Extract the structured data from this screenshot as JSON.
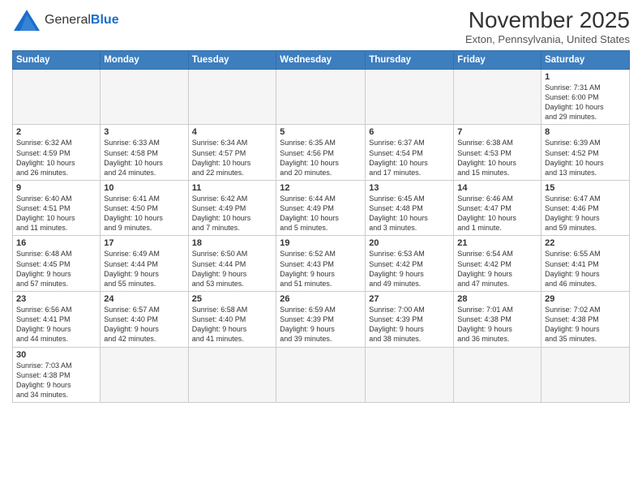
{
  "logo": {
    "text_general": "General",
    "text_blue": "Blue"
  },
  "title": "November 2025",
  "subtitle": "Exton, Pennsylvania, United States",
  "weekdays": [
    "Sunday",
    "Monday",
    "Tuesday",
    "Wednesday",
    "Thursday",
    "Friday",
    "Saturday"
  ],
  "weeks": [
    [
      {
        "day": "",
        "info": ""
      },
      {
        "day": "",
        "info": ""
      },
      {
        "day": "",
        "info": ""
      },
      {
        "day": "",
        "info": ""
      },
      {
        "day": "",
        "info": ""
      },
      {
        "day": "",
        "info": ""
      },
      {
        "day": "1",
        "info": "Sunrise: 7:31 AM\nSunset: 6:00 PM\nDaylight: 10 hours\nand 29 minutes."
      }
    ],
    [
      {
        "day": "2",
        "info": "Sunrise: 6:32 AM\nSunset: 4:59 PM\nDaylight: 10 hours\nand 26 minutes."
      },
      {
        "day": "3",
        "info": "Sunrise: 6:33 AM\nSunset: 4:58 PM\nDaylight: 10 hours\nand 24 minutes."
      },
      {
        "day": "4",
        "info": "Sunrise: 6:34 AM\nSunset: 4:57 PM\nDaylight: 10 hours\nand 22 minutes."
      },
      {
        "day": "5",
        "info": "Sunrise: 6:35 AM\nSunset: 4:56 PM\nDaylight: 10 hours\nand 20 minutes."
      },
      {
        "day": "6",
        "info": "Sunrise: 6:37 AM\nSunset: 4:54 PM\nDaylight: 10 hours\nand 17 minutes."
      },
      {
        "day": "7",
        "info": "Sunrise: 6:38 AM\nSunset: 4:53 PM\nDaylight: 10 hours\nand 15 minutes."
      },
      {
        "day": "8",
        "info": "Sunrise: 6:39 AM\nSunset: 4:52 PM\nDaylight: 10 hours\nand 13 minutes."
      }
    ],
    [
      {
        "day": "9",
        "info": "Sunrise: 6:40 AM\nSunset: 4:51 PM\nDaylight: 10 hours\nand 11 minutes."
      },
      {
        "day": "10",
        "info": "Sunrise: 6:41 AM\nSunset: 4:50 PM\nDaylight: 10 hours\nand 9 minutes."
      },
      {
        "day": "11",
        "info": "Sunrise: 6:42 AM\nSunset: 4:49 PM\nDaylight: 10 hours\nand 7 minutes."
      },
      {
        "day": "12",
        "info": "Sunrise: 6:44 AM\nSunset: 4:49 PM\nDaylight: 10 hours\nand 5 minutes."
      },
      {
        "day": "13",
        "info": "Sunrise: 6:45 AM\nSunset: 4:48 PM\nDaylight: 10 hours\nand 3 minutes."
      },
      {
        "day": "14",
        "info": "Sunrise: 6:46 AM\nSunset: 4:47 PM\nDaylight: 10 hours\nand 1 minute."
      },
      {
        "day": "15",
        "info": "Sunrise: 6:47 AM\nSunset: 4:46 PM\nDaylight: 9 hours\nand 59 minutes."
      }
    ],
    [
      {
        "day": "16",
        "info": "Sunrise: 6:48 AM\nSunset: 4:45 PM\nDaylight: 9 hours\nand 57 minutes."
      },
      {
        "day": "17",
        "info": "Sunrise: 6:49 AM\nSunset: 4:44 PM\nDaylight: 9 hours\nand 55 minutes."
      },
      {
        "day": "18",
        "info": "Sunrise: 6:50 AM\nSunset: 4:44 PM\nDaylight: 9 hours\nand 53 minutes."
      },
      {
        "day": "19",
        "info": "Sunrise: 6:52 AM\nSunset: 4:43 PM\nDaylight: 9 hours\nand 51 minutes."
      },
      {
        "day": "20",
        "info": "Sunrise: 6:53 AM\nSunset: 4:42 PM\nDaylight: 9 hours\nand 49 minutes."
      },
      {
        "day": "21",
        "info": "Sunrise: 6:54 AM\nSunset: 4:42 PM\nDaylight: 9 hours\nand 47 minutes."
      },
      {
        "day": "22",
        "info": "Sunrise: 6:55 AM\nSunset: 4:41 PM\nDaylight: 9 hours\nand 46 minutes."
      }
    ],
    [
      {
        "day": "23",
        "info": "Sunrise: 6:56 AM\nSunset: 4:41 PM\nDaylight: 9 hours\nand 44 minutes."
      },
      {
        "day": "24",
        "info": "Sunrise: 6:57 AM\nSunset: 4:40 PM\nDaylight: 9 hours\nand 42 minutes."
      },
      {
        "day": "25",
        "info": "Sunrise: 6:58 AM\nSunset: 4:40 PM\nDaylight: 9 hours\nand 41 minutes."
      },
      {
        "day": "26",
        "info": "Sunrise: 6:59 AM\nSunset: 4:39 PM\nDaylight: 9 hours\nand 39 minutes."
      },
      {
        "day": "27",
        "info": "Sunrise: 7:00 AM\nSunset: 4:39 PM\nDaylight: 9 hours\nand 38 minutes."
      },
      {
        "day": "28",
        "info": "Sunrise: 7:01 AM\nSunset: 4:38 PM\nDaylight: 9 hours\nand 36 minutes."
      },
      {
        "day": "29",
        "info": "Sunrise: 7:02 AM\nSunset: 4:38 PM\nDaylight: 9 hours\nand 35 minutes."
      }
    ],
    [
      {
        "day": "30",
        "info": "Sunrise: 7:03 AM\nSunset: 4:38 PM\nDaylight: 9 hours\nand 34 minutes."
      },
      {
        "day": "",
        "info": ""
      },
      {
        "day": "",
        "info": ""
      },
      {
        "day": "",
        "info": ""
      },
      {
        "day": "",
        "info": ""
      },
      {
        "day": "",
        "info": ""
      },
      {
        "day": "",
        "info": ""
      }
    ]
  ]
}
